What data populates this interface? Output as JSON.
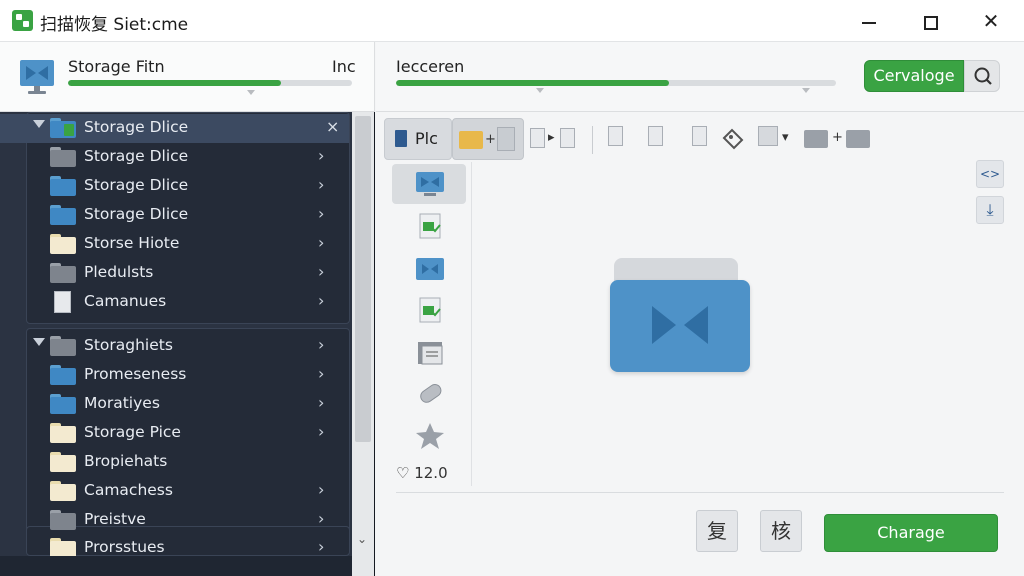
{
  "window": {
    "title": "扫描恢复 Siet:cme",
    "minimize": "minimize",
    "maximize": "maximize",
    "close": "close"
  },
  "left_header": {
    "label": "Storage Fitn",
    "right_label": "Inc",
    "progress": 0.75
  },
  "right_header": {
    "label": "Iecceren",
    "progress": 0.62,
    "primary_button": "Cervaloge",
    "search_icon": "search-icon"
  },
  "sidebar": {
    "group_a": [
      {
        "label": "Storage Dlice",
        "icon": "folder-green",
        "expanded": true,
        "selected": true,
        "action": "×"
      },
      {
        "label": "Storage Dlice",
        "icon": "folder-gray",
        "action": "›"
      },
      {
        "label": "Storage Dlice",
        "icon": "folder-blue",
        "action": "›"
      },
      {
        "label": "Storage Dlice",
        "icon": "folder-blue",
        "action": "›"
      },
      {
        "label": "Storse Hiote",
        "icon": "folder-cream",
        "action": "›"
      },
      {
        "label": "Pledulsts",
        "icon": "folder-gray",
        "action": "›"
      },
      {
        "label": "Camanues",
        "icon": "document",
        "action": "›"
      }
    ],
    "group_b": [
      {
        "label": "Storaghiets",
        "icon": "folder-gray",
        "expanded": true,
        "action": "›"
      },
      {
        "label": "Promeseness",
        "icon": "folder-blue",
        "action": "›"
      },
      {
        "label": "Moratiyes",
        "icon": "folder-blue",
        "action": "›"
      },
      {
        "label": "Storage Pice",
        "icon": "folder-cream",
        "action": "›"
      },
      {
        "label": "Bropiehats",
        "icon": "folder-cream",
        "action": ""
      },
      {
        "label": "Camachess",
        "icon": "folder-cream",
        "action": "›"
      },
      {
        "label": "Preistve",
        "icon": "folder-gray",
        "action": "›"
      }
    ],
    "group_c": [
      {
        "label": "Prorsstues",
        "icon": "folder-cream",
        "action": "›"
      }
    ],
    "scroll_down": "⌄"
  },
  "toolbar": {
    "file_button": "Plc"
  },
  "side_panel": {
    "score": "♡ 12.0"
  },
  "right_tools": {
    "swap": "<>",
    "download": "⤓"
  },
  "footer": {
    "char_button_1": "复",
    "char_button_2": "核",
    "apply_button": "Charage"
  },
  "colors": {
    "accent": "#3aa343",
    "sidebar_bg": "#2b3342",
    "folder_blue": "#4e92c8"
  }
}
